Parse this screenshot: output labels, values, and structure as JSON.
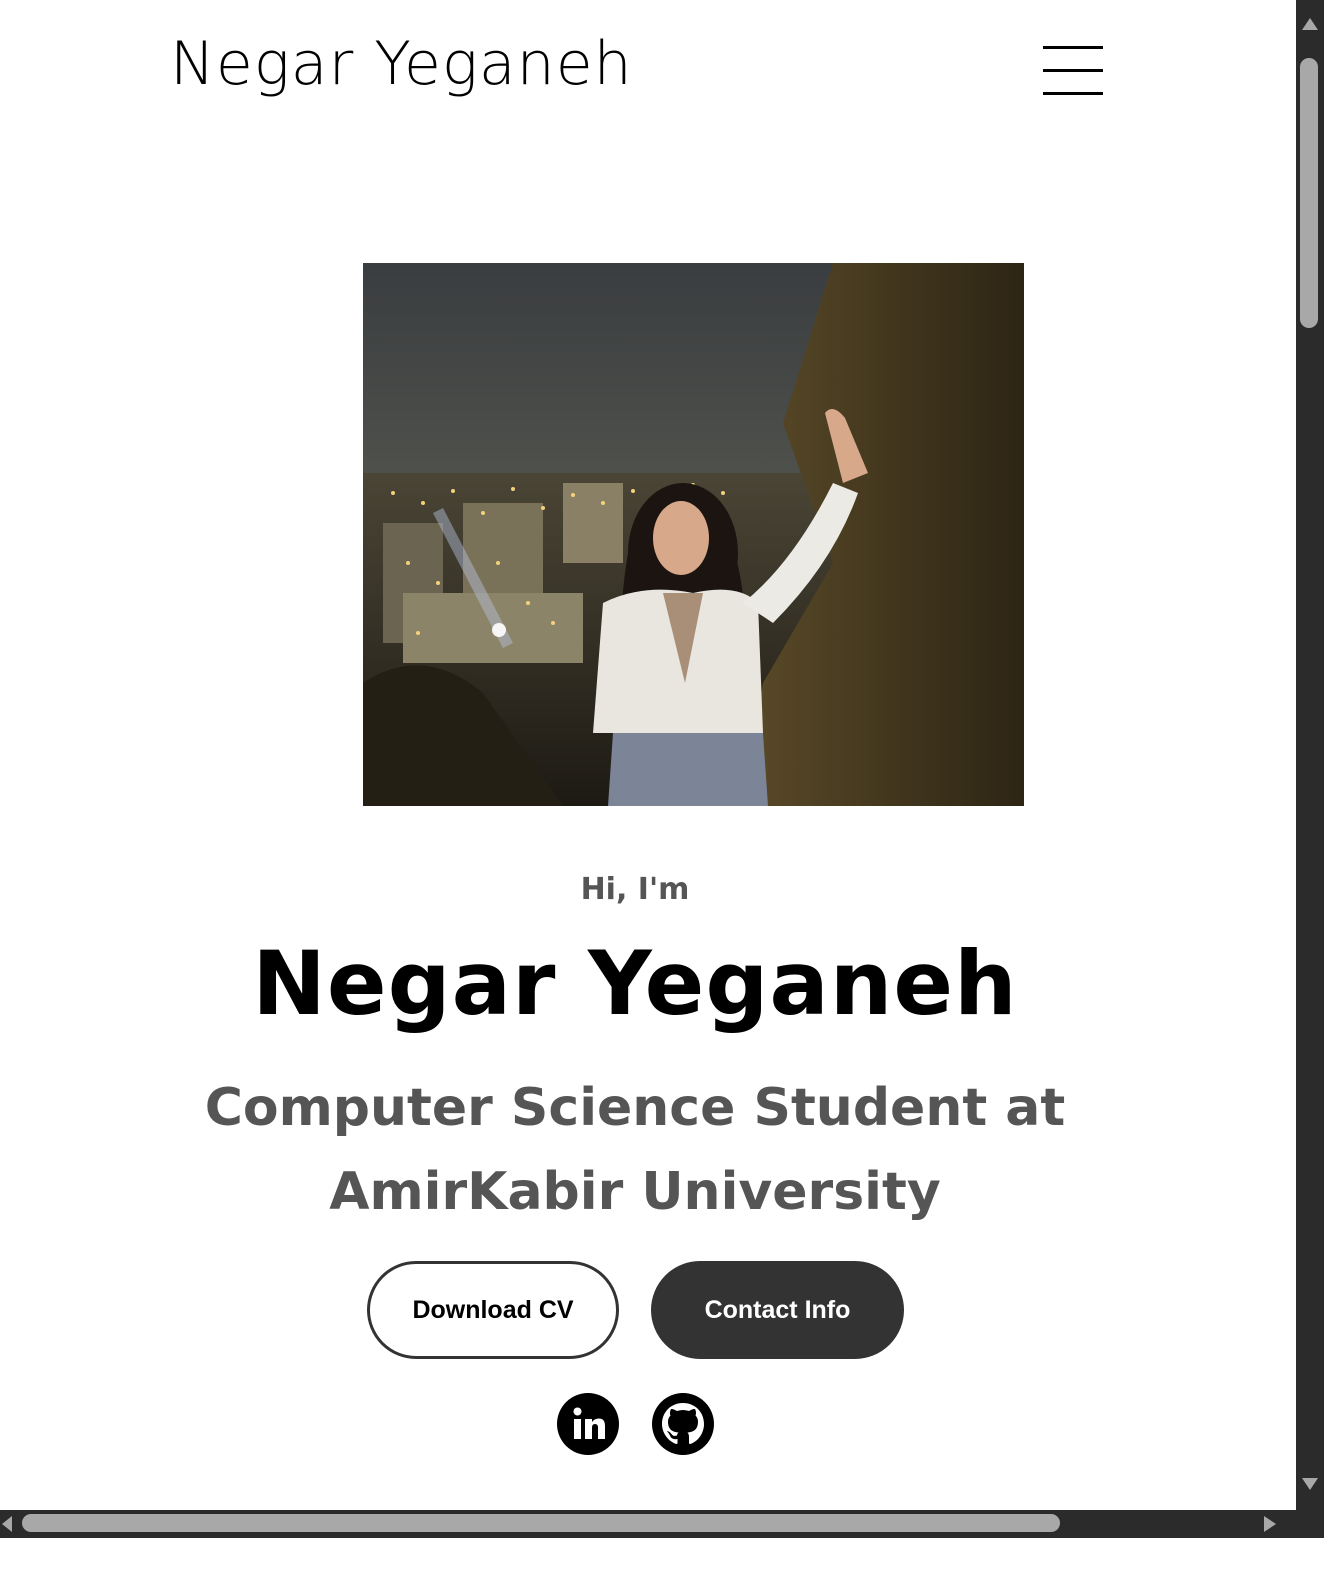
{
  "header": {
    "logo_text": "Negar Yeganeh",
    "menu_icon": "hamburger-menu-icon"
  },
  "profile": {
    "photo_alt": "Profile picture"
  },
  "hero": {
    "greeting": "Hi, I'm",
    "name": "Negar Yeganeh",
    "title": "Computer Science Student at AmirKabir University"
  },
  "buttons": {
    "download_cv": "Download CV",
    "contact_info": "Contact Info"
  },
  "socials": [
    {
      "icon": "linkedin-icon",
      "label": "LinkedIn"
    },
    {
      "icon": "github-icon",
      "label": "GitHub"
    }
  ],
  "colors": {
    "text_primary": "#000000",
    "text_secondary": "#555555",
    "button_dark": "#333333",
    "scrollbar_track": "#2b2b2b",
    "scrollbar_thumb": "#a8a8a8"
  }
}
